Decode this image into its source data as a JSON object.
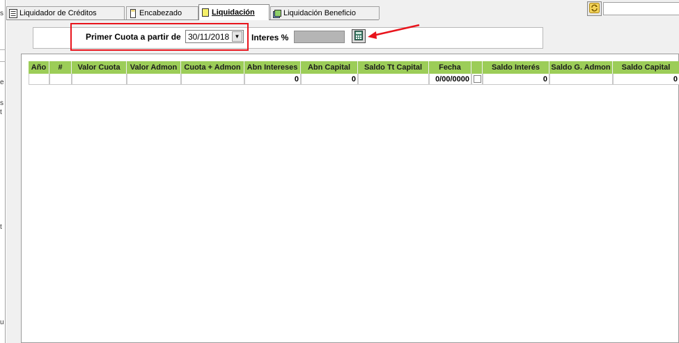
{
  "left_strip": {
    "chars": [
      "s",
      "e",
      "s",
      "t",
      "t",
      "u"
    ]
  },
  "tabs": [
    {
      "label": "Liquidador de Créditos",
      "icon": "list-icon",
      "active": false
    },
    {
      "label": "Encabezado",
      "icon": "document-icon",
      "active": false
    },
    {
      "label": "Liquidación",
      "icon": "note-icon",
      "active": true
    },
    {
      "label": "Liquidación Beneficio",
      "icon": "stack-icon",
      "active": false
    }
  ],
  "toolbar": {
    "refresh_icon": "refresh-icon"
  },
  "form": {
    "first_quota_label": "Primer Cuota a partir de",
    "first_quota_date": "30/11/2018",
    "interest_label": "Interes %",
    "interest_value": "",
    "calc_icon": "calculator-icon"
  },
  "annotation": {
    "color": "#e8141c"
  },
  "grid": {
    "header_color": "#9ccd58",
    "columns": [
      "Año",
      "#",
      "Valor Cuota",
      "Valor Admon",
      "Cuota + Admon",
      "Abn Intereses",
      "Abn Capital",
      "Saldo Tt Capital",
      "Fecha",
      "",
      "Saldo Interés",
      "Saldo G. Admon",
      "Saldo Capital"
    ],
    "rows": [
      [
        "",
        "",
        "",
        "",
        "",
        "0",
        "0",
        "",
        "0/00/0000",
        "",
        "0",
        "",
        "0"
      ]
    ]
  }
}
